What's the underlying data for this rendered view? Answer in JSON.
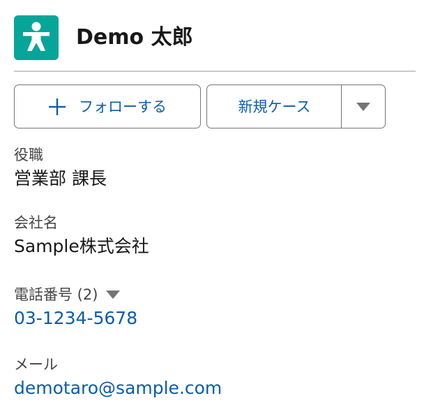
{
  "header": {
    "title": "Demo 太郎",
    "avatar_icon": "person-icon",
    "avatar_color": "#06a59a"
  },
  "actions": {
    "follow_label": "フォローする",
    "follow_icon": "plus-icon",
    "new_case_label": "新規ケース",
    "menu_icon": "chevron-down-icon"
  },
  "fields": {
    "title": {
      "label": "役職",
      "value": "営業部 課長"
    },
    "company": {
      "label": "会社名",
      "value": "Sample株式会社"
    },
    "phone": {
      "label": "電話番号 (2)",
      "value": "03-1234-5678"
    },
    "email": {
      "label": "メール",
      "value": "demotaro@sample.com"
    }
  },
  "colors": {
    "link": "#0b5cab",
    "button_border": "#747474",
    "divider": "#c9c9c9"
  }
}
